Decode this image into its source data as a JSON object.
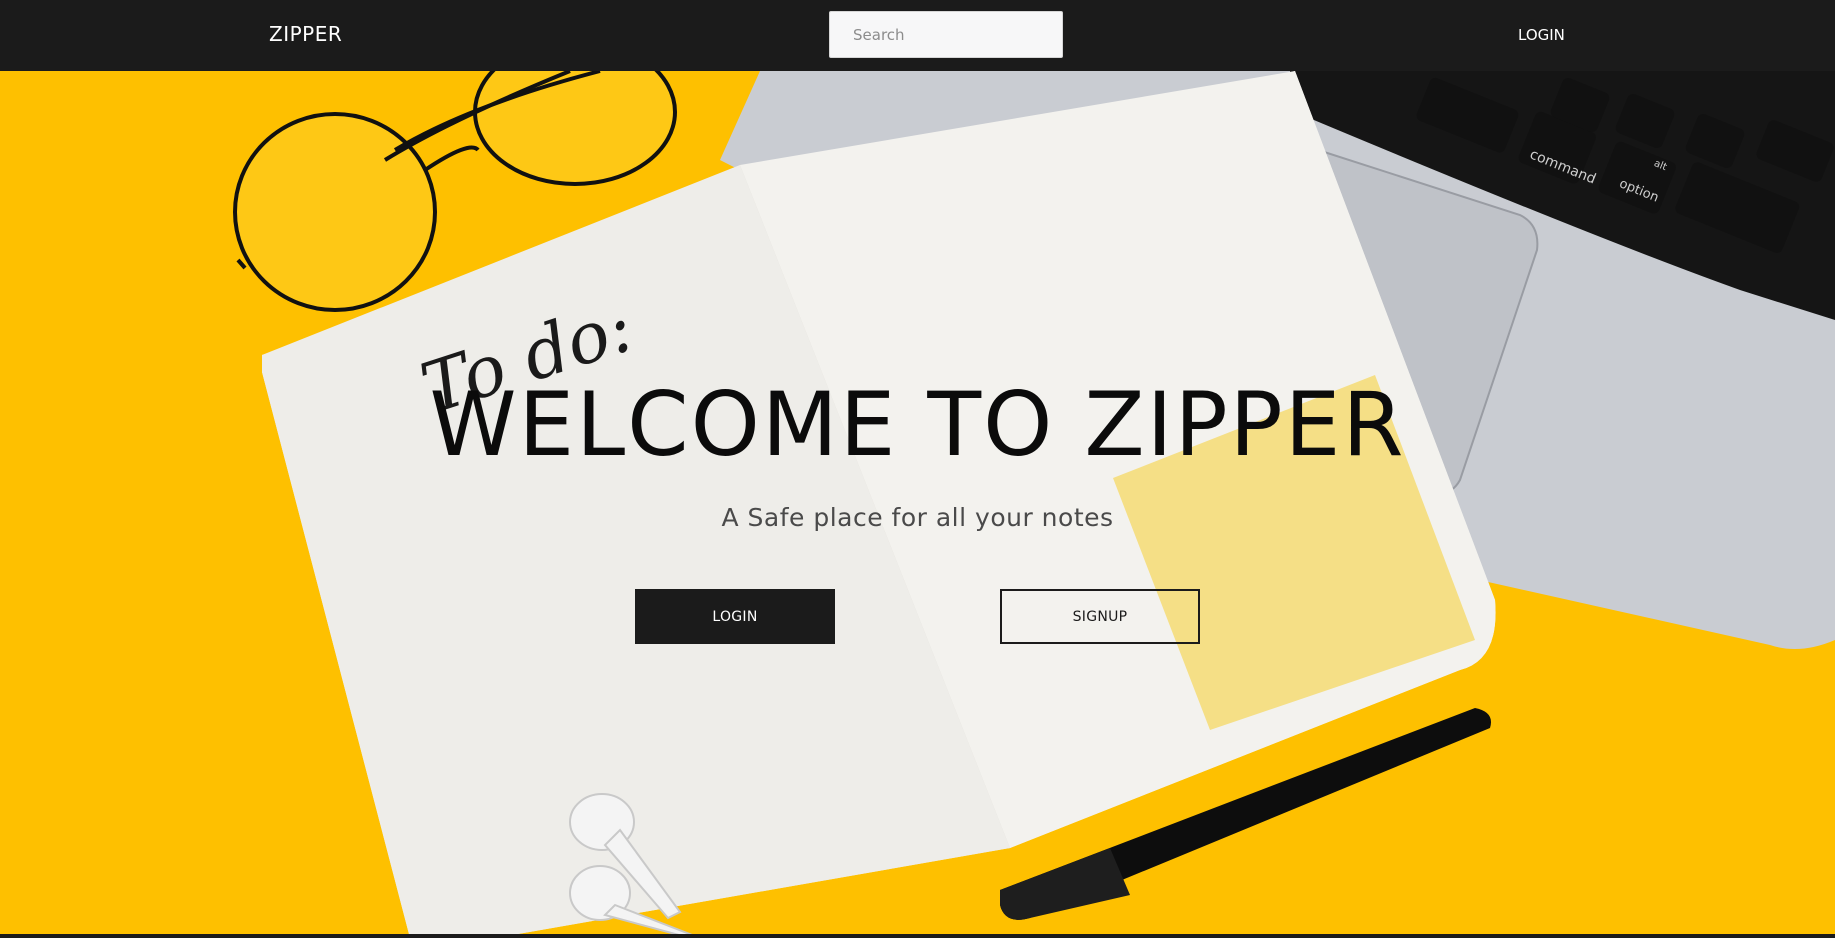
{
  "navbar": {
    "brand": "ZIPPER",
    "search_placeholder": "Search",
    "login_label": "LOGIN"
  },
  "hero": {
    "title": "WELCOME TO ZIPPER",
    "subtitle": "A Safe place for all your notes",
    "login_button": "LOGIN",
    "signup_button": "SIGNUP",
    "notebook_text": "To do:"
  },
  "keyboard": {
    "command_key": "command",
    "option_key": "option",
    "alt_label": "alt"
  },
  "colors": {
    "navbar_bg": "#1b1b1b",
    "background_yellow": "#fec000",
    "primary_button": "#1b1b1b",
    "sticky_note": "#f5df86"
  }
}
